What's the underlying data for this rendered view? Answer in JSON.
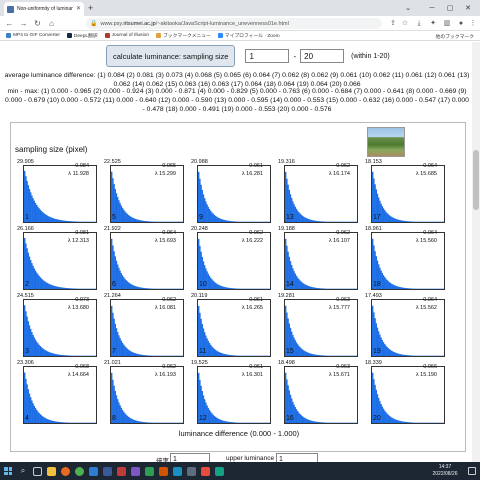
{
  "browser": {
    "tab_title": "Non-uniformity of luminance",
    "url_prefix": "www.psy.",
    "url_domain": "ritsumei.ac.jp",
    "url_path": "/~akitaoka/JavaScript-luminance_unevenness01e.html",
    "bookmarks": [
      {
        "label": "MP4 to GIF Converter",
        "color": "#3b82c4"
      },
      {
        "label": "DeepL翻訳",
        "color": "#0f2b46"
      },
      {
        "label": "Journal of Illusion",
        "color": "#b03a2e"
      },
      {
        "label": "ブックマークメニュー",
        "color": "#e2a03f"
      },
      {
        "label": "マイプロフィール · Zoom",
        "color": "#2d8cff"
      }
    ],
    "other_bookmarks": "他のブックマーク"
  },
  "controls": {
    "button_label": "calculate luminance: sampling size",
    "from_value": "1",
    "dash": "-",
    "to_value": "20",
    "within_text": "(within 1-20)"
  },
  "avg_text": "average luminance difference: (1) 0.084 (2) 0.081 (3) 0.073 (4) 0.068 (5) 0.065 (6) 0.064 (7) 0.062 (8) 0.062 (9) 0.061 (10) 0.062 (11) 0.061 (12) 0.061 (13) 0.062 (14) 0.062 (15) 0.063 (16) 0.063 (17) 0.064 (18) 0.064 (19) 0.064 (20) 0.066",
  "minmax_text": "min - max: (1) 0.000 - 0.965 (2) 0.000 - 0.924 (3) 0.000 - 0.871 (4) 0.000 - 0.829 (5) 0.000 - 0.763 (6) 0.000 - 0.684 (7) 0.000 - 0.641 (8) 0.000 - 0.669 (9) 0.000 - 0.679 (10) 0.000 - 0.572 (11) 0.000 - 0.640 (12) 0.000 - 0.590 (13) 0.000 - 0.595 (14) 0.000 - 0.553 (15) 0.000 - 0.632 (16) 0.000 - 0.547 (17) 0.000 - 0.478 (18) 0.000 - 0.491 (19) 0.000 - 0.553 (20) 0.000 - 0.576",
  "panel": {
    "sampling_label": "sampling size (pixel)",
    "x_label": "luminance difference (0.000 - 1.000)"
  },
  "cells": [
    {
      "idx": "1",
      "max": "29.905",
      "mean": "0.084",
      "lambda": "λ 11.928"
    },
    {
      "idx": "5",
      "max": "22.525",
      "mean": "0.065",
      "lambda": "λ 15.299"
    },
    {
      "idx": "9",
      "max": "20.988",
      "mean": "0.061",
      "lambda": "λ 16.281"
    },
    {
      "idx": "13",
      "max": "19.316",
      "mean": "0.062",
      "lambda": "λ 16.174"
    },
    {
      "idx": "17",
      "max": "18.153",
      "mean": "0.064",
      "lambda": "λ 15.685"
    },
    {
      "idx": "2",
      "max": "26.166",
      "mean": "0.081",
      "lambda": "λ 12.313"
    },
    {
      "idx": "6",
      "max": "21.922",
      "mean": "0.064",
      "lambda": "λ 15.693"
    },
    {
      "idx": "10",
      "max": "20.248",
      "mean": "0.062",
      "lambda": "λ 16.222"
    },
    {
      "idx": "14",
      "max": "19.188",
      "mean": "0.062",
      "lambda": "λ 16.107"
    },
    {
      "idx": "18",
      "max": "18.961",
      "mean": "0.064",
      "lambda": "λ 15.560"
    },
    {
      "idx": "3",
      "max": "24.515",
      "mean": "0.073",
      "lambda": "λ 13.680"
    },
    {
      "idx": "7",
      "max": "21.264",
      "mean": "0.062",
      "lambda": "λ 16.081"
    },
    {
      "idx": "11",
      "max": "20.119",
      "mean": "0.061",
      "lambda": "λ 16.265"
    },
    {
      "idx": "15",
      "max": "19.281",
      "mean": "0.063",
      "lambda": "λ 15.777"
    },
    {
      "idx": "19",
      "max": "17.493",
      "mean": "0.064",
      "lambda": "λ 15.562"
    },
    {
      "idx": "4",
      "max": "23.306",
      "mean": "0.068",
      "lambda": "λ 14.664"
    },
    {
      "idx": "8",
      "max": "21.021",
      "mean": "0.062",
      "lambda": "λ 16.193"
    },
    {
      "idx": "12",
      "max": "19.525",
      "mean": "0.061",
      "lambda": "λ 16.301"
    },
    {
      "idx": "16",
      "max": "18.498",
      "mean": "0.063",
      "lambda": "λ 15.671"
    },
    {
      "idx": "20",
      "max": "18.339",
      "mean": "0.066",
      "lambda": "λ 15.190"
    }
  ],
  "bottom": {
    "ratio_label": "倍率",
    "ratio_value": "1",
    "upper_label": "upper luminance",
    "upper_value": "1"
  },
  "taskbar": {
    "time": "14:37",
    "date": "2022/08/26"
  },
  "colors": {
    "histogram": "#1e6ee6",
    "taskbar": "#1c2733"
  }
}
